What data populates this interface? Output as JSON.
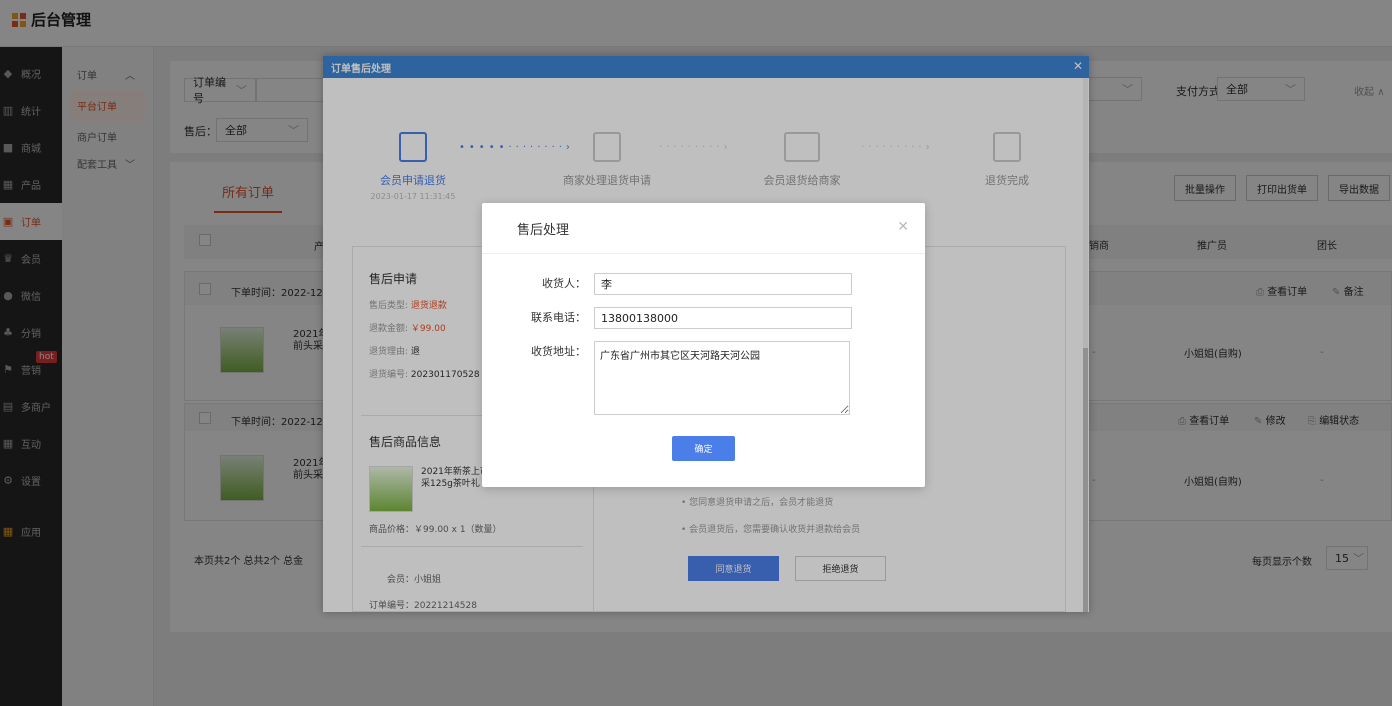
{
  "app": {
    "title": "后台管理"
  },
  "sidebar": {
    "items": [
      {
        "icon": "概",
        "label": "概况"
      },
      {
        "icon": "统",
        "label": "统计"
      },
      {
        "icon": "商",
        "label": "商城"
      },
      {
        "icon": "产",
        "label": "产品"
      },
      {
        "icon": "订",
        "label": "订单"
      },
      {
        "icon": "会",
        "label": "会员"
      },
      {
        "icon": "微",
        "label": "微信"
      },
      {
        "icon": "分",
        "label": "分销"
      },
      {
        "icon": "营",
        "label": "营销",
        "badge": "hot"
      },
      {
        "icon": "多",
        "label": "多商户"
      },
      {
        "icon": "互",
        "label": "互动"
      },
      {
        "icon": "设",
        "label": "设置"
      },
      {
        "icon": "应",
        "label": "应用"
      }
    ]
  },
  "subnav": {
    "group": "订单",
    "items": [
      "平台订单",
      "商户订单"
    ],
    "tools": "配套工具"
  },
  "filters": {
    "order_no": "订单编号",
    "aftersale_label": "售后：",
    "aftersale_value": "全部",
    "pay_label": "支付方式：",
    "pay_value": "全部",
    "collapse": "收起"
  },
  "tabs": {
    "all": "所有订单"
  },
  "actions": {
    "batch": "批量操作",
    "print": "打印出货单",
    "export": "导出数据"
  },
  "table": {
    "headers": [
      "产",
      "销商",
      "推广员",
      "团长"
    ]
  },
  "orders": [
    {
      "time": "下单时间：2022-12-",
      "product": "2021年",
      "product2": "前头采",
      "promoter": "小姐姐(自购)",
      "dash": "-",
      "dash2": "-",
      "links": [
        "查看订单",
        "备注"
      ]
    },
    {
      "time": "下单时间：2022-12-",
      "product": "2021年",
      "product2": "前头采",
      "promoter": "小姐姐(自购)",
      "dash": "-",
      "dash2": "-",
      "links": [
        "查看订单",
        "修改",
        "编辑状态"
      ]
    }
  ],
  "pagination": {
    "summary": "本页共2个  总共2个  总金",
    "per_page": "每页显示个数",
    "size": "15"
  },
  "modal": {
    "title": "订单售后处理",
    "steps": [
      {
        "label": "会员申请退货",
        "time": "2023-01-17 11:31:45"
      },
      {
        "label": "商家处理退货申请"
      },
      {
        "label": "会员退货给商家"
      },
      {
        "label": "退货完成"
      }
    ],
    "apply": {
      "heading": "售后申请",
      "type_label": "售后类型:",
      "type_value": "退货退款",
      "amount_label": "退款金额:",
      "amount_value": "￥99.00",
      "reason_label": "退货理由:",
      "reason_value": "退",
      "no_label": "退货编号:",
      "no_value": "202301170528"
    },
    "goods": {
      "heading": "售后商品信息",
      "name": "2021年新茶上市",
      "name2": "采125g茶叶礼",
      "price": "商品价格：￥99.00 x 1（数量）",
      "member": "会员：小姐姐",
      "order_no": "订单编号：20221214528"
    },
    "notes": [
      "您同意退货申请之后，会员才能退货",
      "会员退货后，您需要确认收货并退款给会员"
    ],
    "agree": "同意退货",
    "reject": "拒绝退货"
  },
  "dialog": {
    "title": "售后处理",
    "receiver_label": "收货人：",
    "receiver_value": "李",
    "phone_label": "联系电话：",
    "phone_value": "13800138000",
    "address_label": "收货地址：",
    "address_value": "广东省广州市其它区天河路天河公园",
    "confirm": "确定"
  }
}
